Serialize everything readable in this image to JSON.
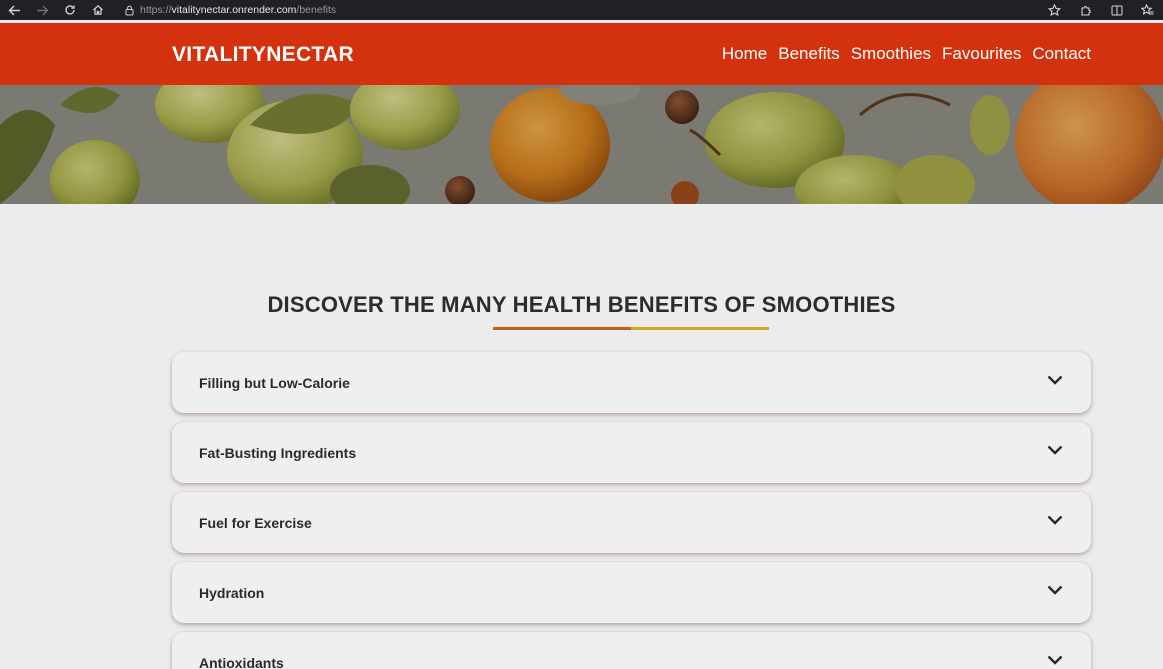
{
  "browser": {
    "url_prefix": "https://",
    "url_host": "vitalitynectar.onrender.com",
    "url_path": "/benefits",
    "icons": [
      "back-arrow-icon",
      "forward-arrow-icon",
      "reload-icon",
      "home-icon",
      "lock-icon",
      "star-icon",
      "extensions-icon",
      "split-screen-icon",
      "favorites-icon"
    ]
  },
  "header": {
    "logo_part1": "VITALITY",
    "logo_part2": "NECTAR",
    "nav": [
      {
        "label": "Home"
      },
      {
        "label": "Benefits"
      },
      {
        "label": "Smoothies"
      },
      {
        "label": "Favourites"
      },
      {
        "label": "Contact"
      }
    ],
    "bg_color": "#d4320f"
  },
  "main": {
    "title": "DISCOVER THE MANY HEALTH BENEFITS OF SMOOTHIES",
    "underline_colors": [
      "#c85a1a",
      "#d3a520"
    ],
    "accordion": [
      {
        "label": "Filling but Low-Calorie"
      },
      {
        "label": "Fat-Busting Ingredients"
      },
      {
        "label": "Fuel for Exercise"
      },
      {
        "label": "Hydration"
      },
      {
        "label": "Antioxidants"
      }
    ]
  }
}
